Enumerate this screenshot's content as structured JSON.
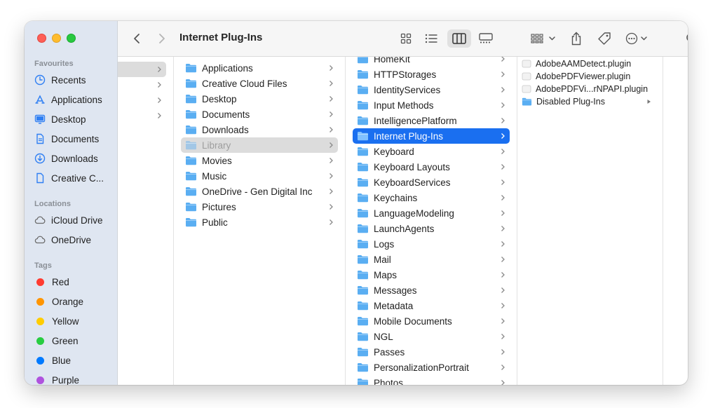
{
  "window": {
    "title": "Internet Plug-Ins"
  },
  "sidebar": {
    "favourites_heading": "Favourites",
    "favourites": [
      {
        "label": "Recents",
        "icon": "clock-icon"
      },
      {
        "label": "Applications",
        "icon": "applications-icon"
      },
      {
        "label": "Desktop",
        "icon": "desktop-icon"
      },
      {
        "label": "Documents",
        "icon": "document-icon"
      },
      {
        "label": "Downloads",
        "icon": "download-icon"
      },
      {
        "label": "Creative C...",
        "icon": "file-icon"
      }
    ],
    "locations_heading": "Locations",
    "locations": [
      {
        "label": "iCloud Drive",
        "icon": "cloud-icon"
      },
      {
        "label": "OneDrive",
        "icon": "cloud-icon"
      }
    ],
    "tags_heading": "Tags",
    "tags": [
      {
        "label": "Red",
        "color": "#ff3b30"
      },
      {
        "label": "Orange",
        "color": "#ff9500"
      },
      {
        "label": "Yellow",
        "color": "#ffcc00"
      },
      {
        "label": "Green",
        "color": "#28cd41"
      },
      {
        "label": "Blue",
        "color": "#007aff"
      },
      {
        "label": "Purple",
        "color": "#af52de"
      }
    ]
  },
  "toolbar": {
    "icons": [
      "chevron-left-icon",
      "chevron-right-icon",
      "icon-view-icon",
      "list-view-icon",
      "column-view-icon",
      "gallery-view-icon",
      "group-icon",
      "share-icon",
      "tag-icon",
      "more-icon",
      "search-icon"
    ]
  },
  "columns": {
    "home": [
      "Applications",
      "Creative Cloud Files",
      "Desktop",
      "Documents",
      "Downloads",
      "Library",
      "Movies",
      "Music",
      "OneDrive - Gen Digital Inc",
      "Pictures",
      "Public"
    ],
    "library": [
      "HomeKit",
      "HTTPStorages",
      "IdentityServices",
      "Input Methods",
      "IntelligencePlatform",
      "Internet Plug-Ins",
      "Keyboard",
      "Keyboard Layouts",
      "KeyboardServices",
      "Keychains",
      "LanguageModeling",
      "LaunchAgents",
      "Logs",
      "Mail",
      "Maps",
      "Messages",
      "Metadata",
      "Mobile Documents",
      "NGL",
      "Passes",
      "PersonalizationPortrait",
      "Photos"
    ],
    "plugins": [
      {
        "label": "AdobeAAMDetect.plugin",
        "kind": "plugin"
      },
      {
        "label": "AdobePDFViewer.plugin",
        "kind": "plugin"
      },
      {
        "label": "AdobePDFVi...rNPAPI.plugin",
        "kind": "plugin"
      },
      {
        "label": "Disabled Plug-Ins",
        "kind": "folder"
      }
    ]
  },
  "colors": {
    "accent": "#1a6ff0",
    "folder": "#5aaef2"
  }
}
